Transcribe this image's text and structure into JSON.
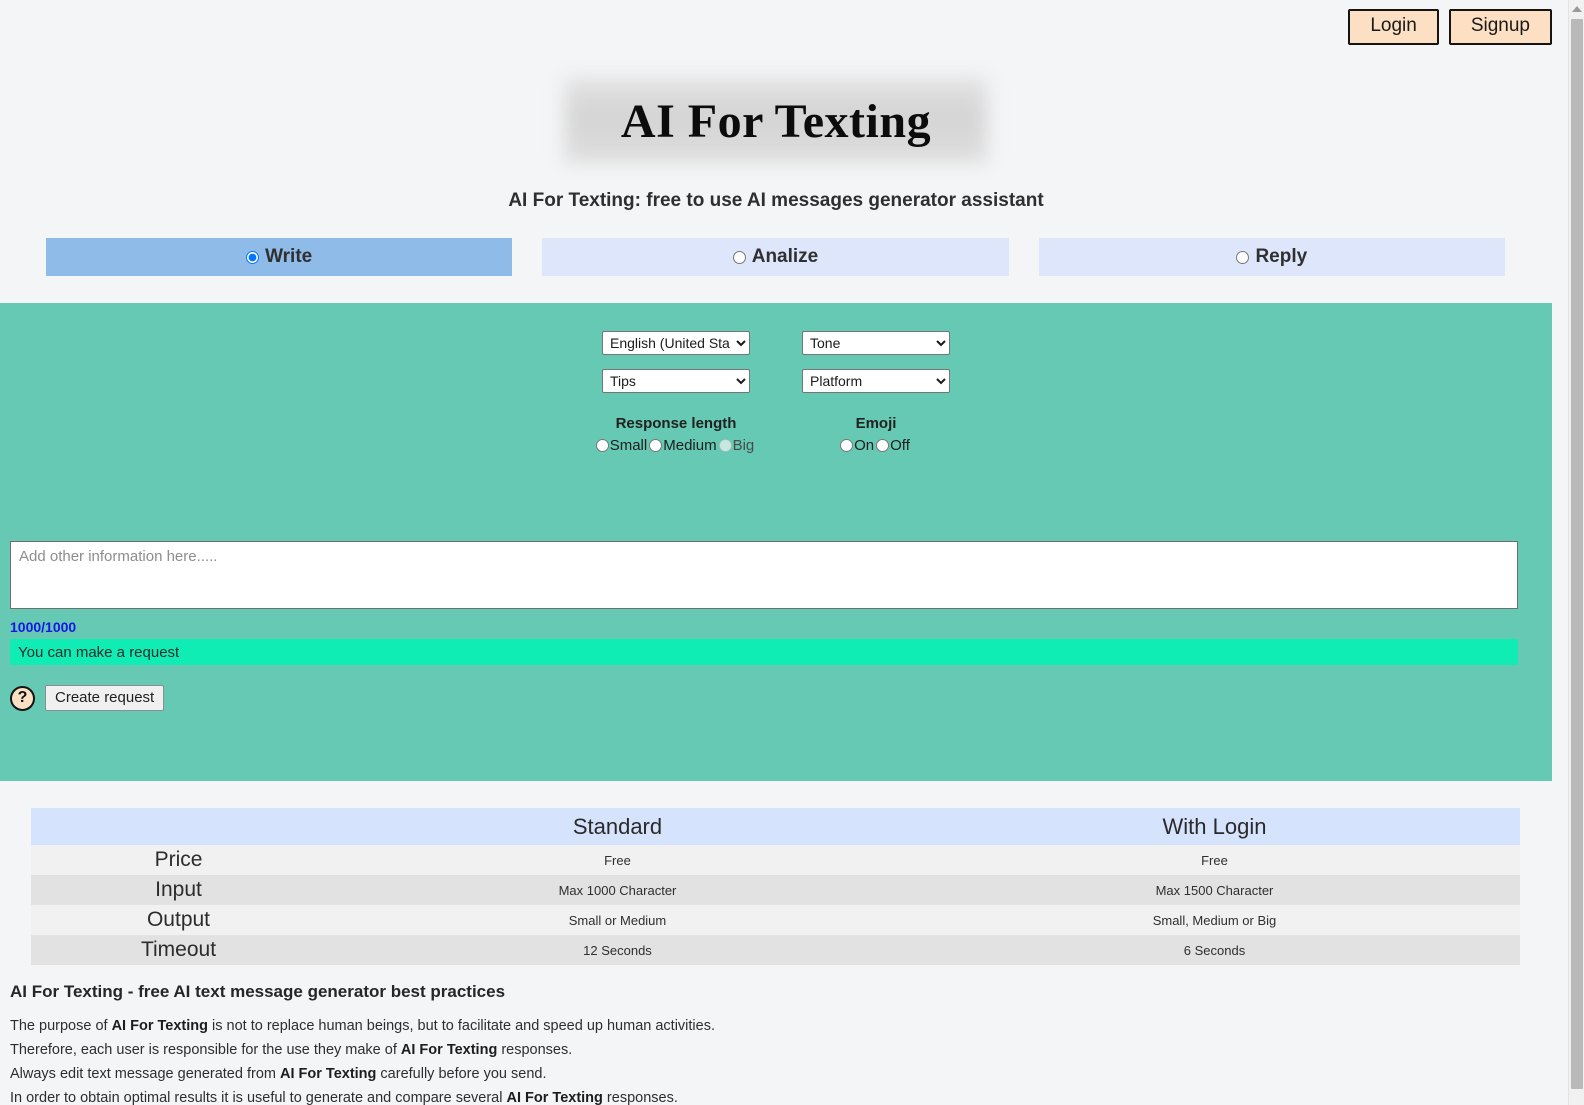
{
  "auth": {
    "login_label": "Login",
    "signup_label": "Signup"
  },
  "header": {
    "title": "AI For Texting",
    "subtitle": "AI For Texting: free to use AI messages generator assistant"
  },
  "tabs": [
    {
      "label": "Write",
      "selected": true
    },
    {
      "label": "Analize",
      "selected": false
    },
    {
      "label": "Reply",
      "selected": false
    }
  ],
  "form": {
    "language_select": {
      "value": "English (United States)",
      "name": "language"
    },
    "tone_select": {
      "value": "Tone",
      "name": "tone"
    },
    "tips_select": {
      "value": "Tips",
      "name": "tips"
    },
    "platform_select": {
      "value": "Platform",
      "name": "platform"
    },
    "response_length": {
      "title": "Response length",
      "options": [
        {
          "label": "Small",
          "checked": false,
          "disabled": false
        },
        {
          "label": "Medium",
          "checked": false,
          "disabled": false
        },
        {
          "label": "Big",
          "checked": false,
          "disabled": true
        }
      ]
    },
    "emoji": {
      "title": "Emoji",
      "options": [
        {
          "label": "On",
          "checked": false,
          "disabled": false
        },
        {
          "label": "Off",
          "checked": false,
          "disabled": false
        }
      ]
    },
    "textarea": {
      "placeholder": "Add other information here.....",
      "value": ""
    },
    "counter": "1000/1000",
    "status": "You can make a request",
    "help_icon_label": "?",
    "create_button": "Create request"
  },
  "comparison": {
    "columns": [
      "",
      "Standard",
      "With Login"
    ],
    "rows": [
      {
        "label": "Price",
        "standard": "Free",
        "with_login": "Free"
      },
      {
        "label": "Input",
        "standard": "Max 1000 Character",
        "with_login": "Max 1500 Character"
      },
      {
        "label": "Output",
        "standard": "Small or Medium",
        "with_login": "Small, Medium or Big"
      },
      {
        "label": "Timeout",
        "standard": "12 Seconds",
        "with_login": "6 Seconds"
      }
    ]
  },
  "footer": {
    "heading": "AI For Texting - free AI text message generator best practices",
    "lines": [
      {
        "pre": "The purpose of ",
        "bold": "AI For Texting",
        "post": " is not to replace human beings, but to facilitate and speed up human activities."
      },
      {
        "pre": "Therefore, each user is responsible for the use they make of ",
        "bold": "AI For Texting",
        "post": " responses."
      },
      {
        "pre": "Always edit text message generated from ",
        "bold": "AI For Texting",
        "post": " carefully before you send."
      },
      {
        "pre": "In order to obtain optimal results it is useful to generate and compare several ",
        "bold": "AI For Texting",
        "post": " responses."
      }
    ]
  },
  "colors": {
    "panel_teal": "#66c9b3",
    "status_green": "#0fedb5",
    "tab_active": "#8fbbe8",
    "tab_inactive": "#dde6fb",
    "auth_button": "#fde0c3",
    "counter_blue": "#1616e8",
    "table_header": "#d6e3fd"
  }
}
